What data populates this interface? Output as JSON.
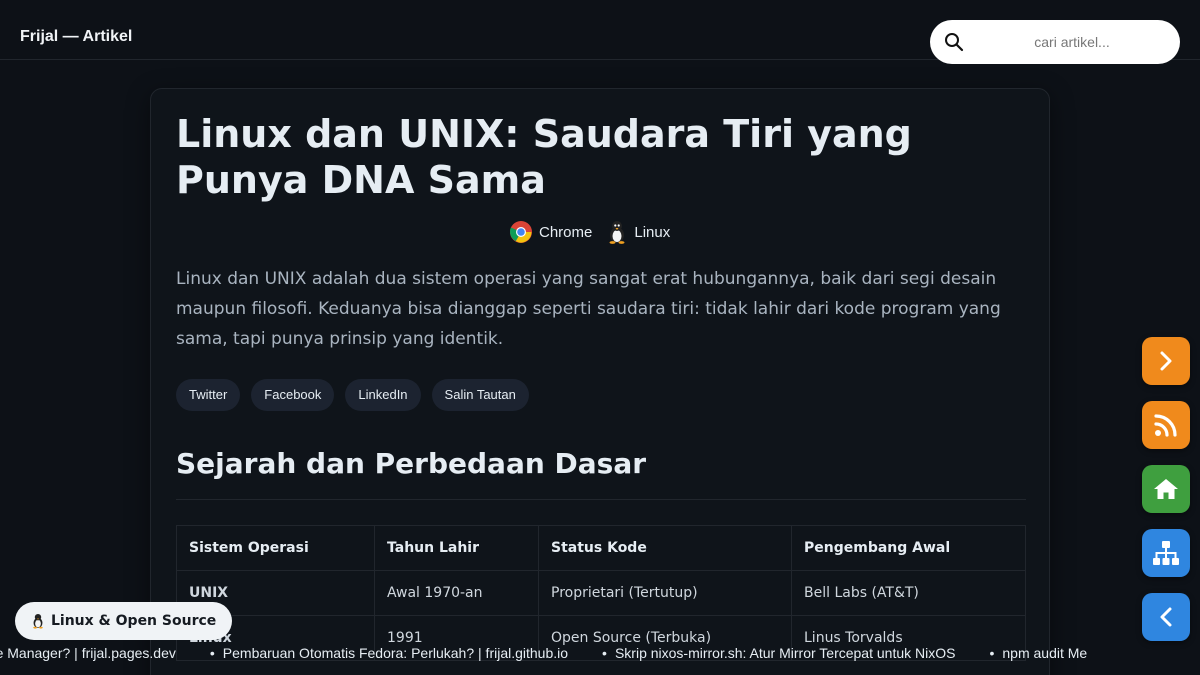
{
  "header": {
    "brand": "Frijal — Artikel",
    "search_placeholder": "cari artikel..."
  },
  "article": {
    "title": "Linux dan UNIX: Saudara Tiri yang Punya DNA Sama",
    "meta": [
      {
        "label": "Chrome",
        "icon": "chrome-icon"
      },
      {
        "label": "Linux",
        "icon": "penguin-icon"
      }
    ],
    "lead": "Linux dan UNIX adalah dua sistem operasi yang sangat erat hubungannya, baik dari segi desain maupun filosofi. Keduanya bisa dianggap seperti saudara tiri: tidak lahir dari kode program yang sama, tapi punya prinsip yang identik.",
    "share": [
      "Twitter",
      "Facebook",
      "LinkedIn",
      "Salin Tautan"
    ],
    "section_title": "Sejarah dan Perbedaan Dasar",
    "table": {
      "headers": [
        "Sistem Operasi",
        "Tahun Lahir",
        "Status Kode",
        "Pengembang Awal"
      ],
      "rows": [
        [
          "UNIX",
          "Awal 1970-an",
          "Proprietari (Tertutup)",
          "Bell Labs (AT&T)"
        ],
        [
          "Linux",
          "1991",
          "Open Source (Terbuka)",
          "Linus Torvalds"
        ]
      ]
    }
  },
  "fabs": [
    {
      "icon": "chevron-right-icon",
      "color": "#f08a1c"
    },
    {
      "icon": "rss-icon",
      "color": "#f08a1c"
    },
    {
      "icon": "home-icon",
      "color": "#3f9f3f"
    },
    {
      "icon": "sitemap-icon",
      "color": "#2f86e0"
    },
    {
      "icon": "chevron-left-icon",
      "color": "#2f86e0"
    }
  ],
  "badge": {
    "icon": "penguin-icon",
    "label": "Linux & Open Source"
  },
  "ticker": [
    "age Manager? | frijal.pages.dev",
    "Pembaruan Otomatis Fedora: Perlukah? | frijal.github.io",
    "Skrip nixos-mirror.sh: Atur Mirror Tercepat untuk NixOS",
    "npm audit Me"
  ],
  "colors": {
    "background": "#0d1117",
    "card": "#0f141a",
    "orange": "#f08a1c",
    "green": "#3f9f3f",
    "blue": "#2f86e0"
  }
}
